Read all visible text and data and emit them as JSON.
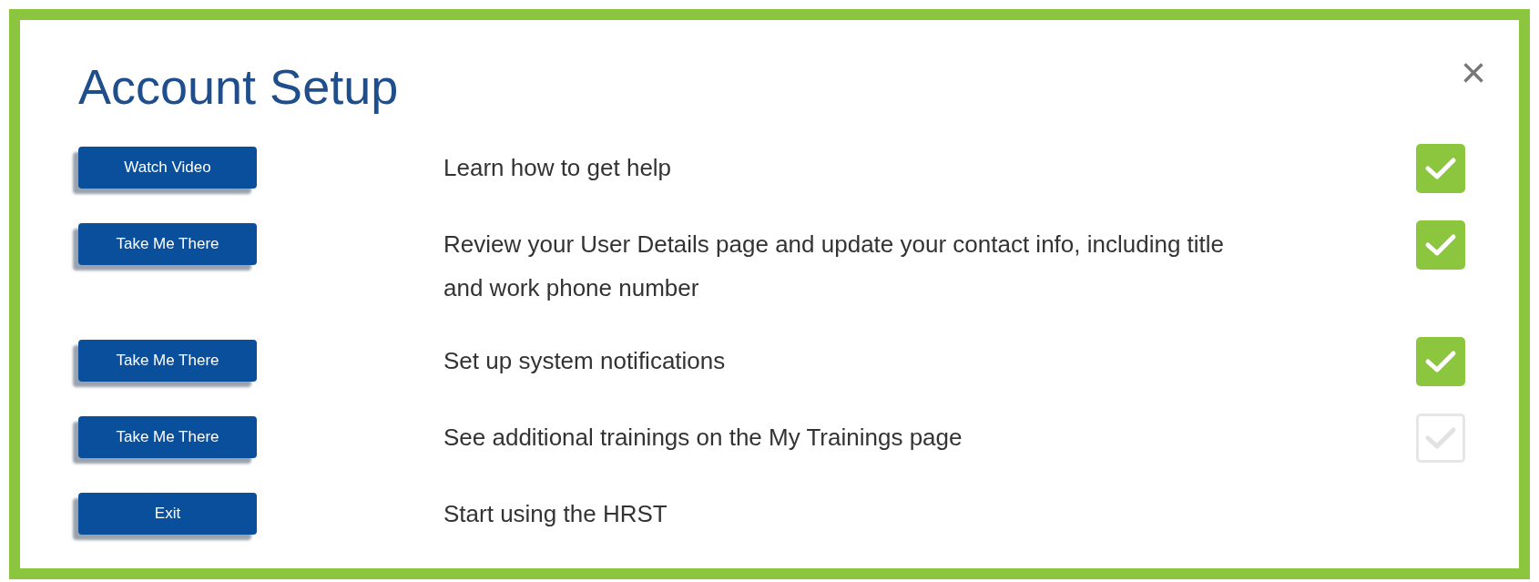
{
  "dialog": {
    "title": "Account Setup",
    "close": "×"
  },
  "tasks": [
    {
      "kind": "checkbox",
      "button": "Watch Video",
      "text": "Learn how to get help",
      "checked": true
    },
    {
      "kind": "checkbox",
      "button": "Take Me There",
      "text": "Review your User Details page and update your contact info, including title and work phone number",
      "checked": true
    },
    {
      "kind": "checkbox",
      "button": "Take Me There",
      "text": "Set up system notifications",
      "checked": true
    },
    {
      "kind": "checkbox",
      "button": "Take Me There",
      "text": "See additional trainings on the My Trainings page",
      "checked": false
    },
    {
      "kind": "plain",
      "button": "Exit",
      "text": "Start using the HRST"
    }
  ]
}
